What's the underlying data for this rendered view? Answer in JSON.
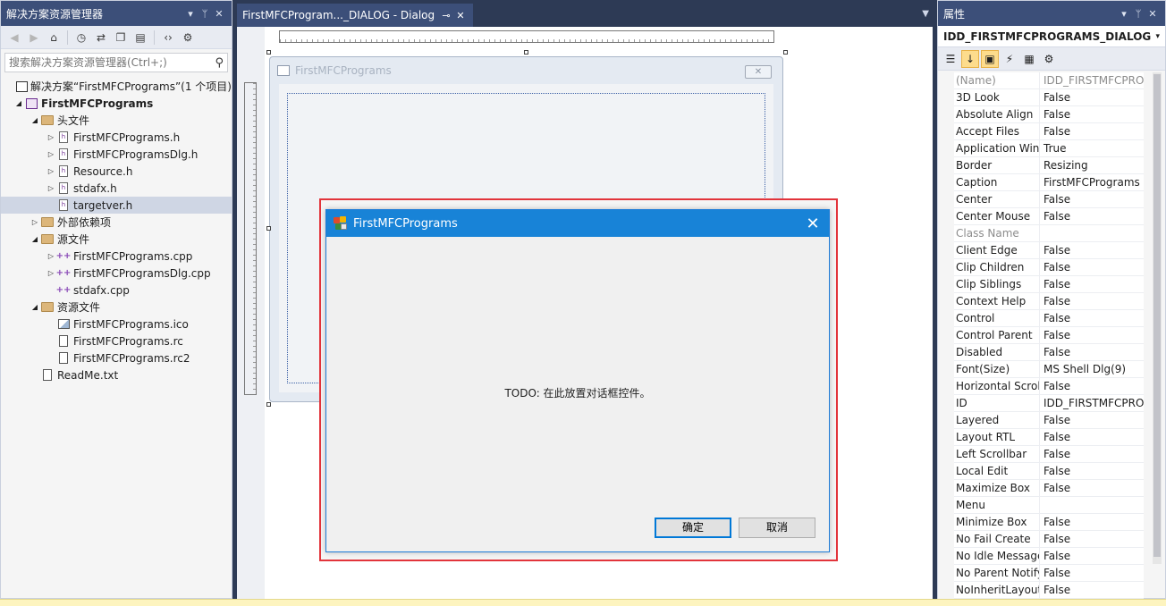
{
  "solution_explorer": {
    "title": "解决方案资源管理器",
    "title_buttons": [
      "▾",
      "ᛘ",
      "✕"
    ],
    "search_placeholder": "搜索解决方案资源管理器(Ctrl+;)",
    "search_icon": "search-icon",
    "tree": [
      {
        "label": "解决方案“FirstMFCPrograms”(1 个项目)",
        "icon": "solution-icon",
        "indent": 0,
        "expander": ""
      },
      {
        "label": "FirstMFCPrograms",
        "icon": "project-icon",
        "indent": 0,
        "expander": "◢",
        "bold": true
      },
      {
        "label": "头文件",
        "icon": "folder-icon",
        "indent": 1,
        "expander": "◢"
      },
      {
        "label": "FirstMFCPrograms.h",
        "icon": "header-file-icon",
        "indent": 2,
        "expander": "▷"
      },
      {
        "label": "FirstMFCProgramsDlg.h",
        "icon": "header-file-icon",
        "indent": 2,
        "expander": "▷"
      },
      {
        "label": "Resource.h",
        "icon": "header-file-icon",
        "indent": 2,
        "expander": "▷"
      },
      {
        "label": "stdafx.h",
        "icon": "header-file-icon",
        "indent": 2,
        "expander": "▷"
      },
      {
        "label": "targetver.h",
        "icon": "header-file-icon",
        "indent": 2,
        "expander": "",
        "selected": true
      },
      {
        "label": "外部依赖项",
        "icon": "folder-icon",
        "indent": 1,
        "expander": "▷"
      },
      {
        "label": "源文件",
        "icon": "folder-icon",
        "indent": 1,
        "expander": "◢"
      },
      {
        "label": "FirstMFCPrograms.cpp",
        "icon": "cpp-file-icon",
        "indent": 2,
        "expander": "▷"
      },
      {
        "label": "FirstMFCProgramsDlg.cpp",
        "icon": "cpp-file-icon",
        "indent": 2,
        "expander": "▷"
      },
      {
        "label": "stdafx.cpp",
        "icon": "cpp-file-icon",
        "indent": 2,
        "expander": ""
      },
      {
        "label": "资源文件",
        "icon": "folder-icon",
        "indent": 1,
        "expander": "◢"
      },
      {
        "label": "FirstMFCPrograms.ico",
        "icon": "image-file-icon",
        "indent": 2,
        "expander": ""
      },
      {
        "label": "FirstMFCPrograms.rc",
        "icon": "resource-file-icon",
        "indent": 2,
        "expander": ""
      },
      {
        "label": "FirstMFCPrograms.rc2",
        "icon": "resource-file-icon",
        "indent": 2,
        "expander": ""
      },
      {
        "label": "ReadMe.txt",
        "icon": "text-file-icon",
        "indent": 1,
        "expander": ""
      }
    ]
  },
  "editor": {
    "tab_label": "FirstMFCProgram..._DIALOG - Dialog",
    "pin_glyph": "⊸",
    "close_glyph": "✕",
    "dropdown_glyph": "▼",
    "ghost_dialog_caption": "FirstMFCPrograms",
    "ghost_close_glyph": "✕"
  },
  "properties": {
    "title": "属性",
    "title_buttons": [
      "▾",
      "ᛘ",
      "✕"
    ],
    "object": "IDD_FIRSTMFCPROGRAMS_DIALOG (",
    "object_dropdown": "▾",
    "rows": [
      {
        "name": "(Name)",
        "value": "IDD_FIRSTMFCPRO",
        "gray": true
      },
      {
        "name": "3D Look",
        "value": "False"
      },
      {
        "name": "Absolute Align",
        "value": "False"
      },
      {
        "name": "Accept Files",
        "value": "False"
      },
      {
        "name": "Application Wind",
        "value": "True"
      },
      {
        "name": "Border",
        "value": "Resizing"
      },
      {
        "name": "Caption",
        "value": "FirstMFCPrograms"
      },
      {
        "name": "Center",
        "value": "False"
      },
      {
        "name": "Center Mouse",
        "value": "False"
      },
      {
        "name": "Class Name",
        "value": "",
        "gray": true
      },
      {
        "name": "Client Edge",
        "value": "False"
      },
      {
        "name": "Clip Children",
        "value": "False"
      },
      {
        "name": "Clip Siblings",
        "value": "False"
      },
      {
        "name": "Context Help",
        "value": "False"
      },
      {
        "name": "Control",
        "value": "False"
      },
      {
        "name": "Control Parent",
        "value": "False"
      },
      {
        "name": "Disabled",
        "value": "False"
      },
      {
        "name": "Font(Size)",
        "value": "MS Shell Dlg(9)"
      },
      {
        "name": "Horizontal Scroll",
        "value": "False"
      },
      {
        "name": "ID",
        "value": "IDD_FIRSTMFCPRO"
      },
      {
        "name": "Layered",
        "value": "False"
      },
      {
        "name": "Layout RTL",
        "value": "False"
      },
      {
        "name": "Left Scrollbar",
        "value": "False"
      },
      {
        "name": "Local Edit",
        "value": "False"
      },
      {
        "name": "Maximize Box",
        "value": "False"
      },
      {
        "name": "Menu",
        "value": ""
      },
      {
        "name": "Minimize Box",
        "value": "False"
      },
      {
        "name": "No Fail Create",
        "value": "False"
      },
      {
        "name": "No Idle Message",
        "value": "False"
      },
      {
        "name": "No Parent Notify",
        "value": "False"
      },
      {
        "name": "NoInheritLayout",
        "value": "False"
      }
    ]
  },
  "running_dialog": {
    "title": "FirstMFCPrograms",
    "close_glyph": "✕",
    "message": "TODO:  在此放置对话框控件。",
    "ok_label": "确定",
    "cancel_label": "取消"
  },
  "colors": {
    "highlight_frame": "#e2343b",
    "dialog_titlebar": "#1883d7",
    "ide_frame": "#2d3a55",
    "panel_title": "#3c4f79"
  }
}
